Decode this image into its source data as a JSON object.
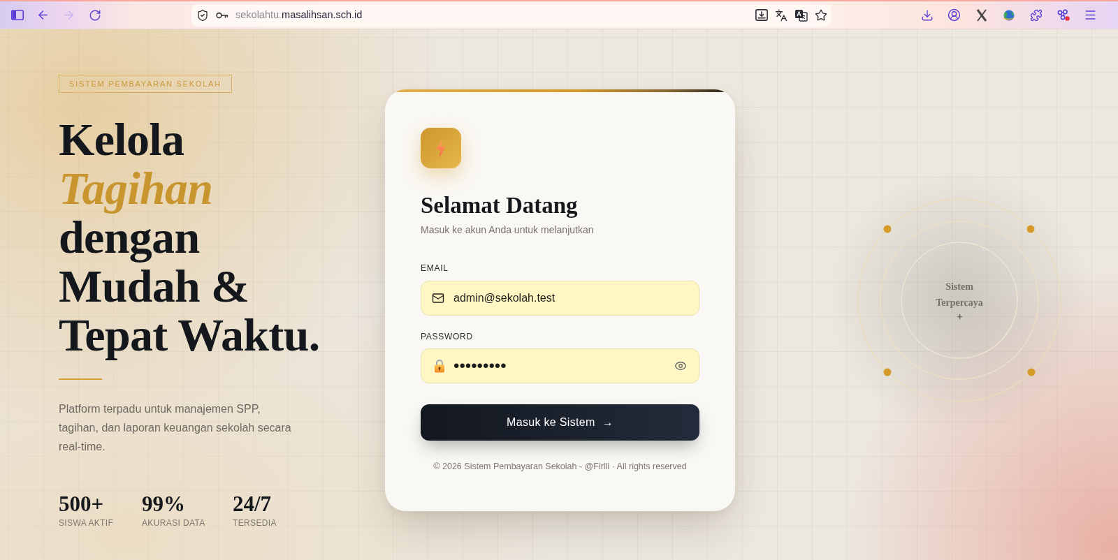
{
  "browser": {
    "forward_disabled": true,
    "url_prefix": "sekolahtu.",
    "url_host": "masalihsan.sch.id"
  },
  "hero": {
    "badge": "SISTEM PEMBAYARAN SEKOLAH",
    "headline": [
      {
        "text": "Kelola",
        "kind": "plain"
      },
      {
        "text": "Tagihan",
        "kind": "accent"
      },
      {
        "text": "dengan",
        "kind": "plain"
      },
      {
        "text": "Mudah &",
        "kind": "plain"
      },
      {
        "text": "Tepat Waktu.",
        "kind": "plain"
      }
    ],
    "description": "Platform terpadu untuk manajemen SPP, tagihan, dan laporan keuangan sekolah secara real-time.",
    "stats": [
      {
        "value": "500+",
        "label": "SISWA AKTIF"
      },
      {
        "value": "99%",
        "label": "AKURASI DATA"
      },
      {
        "value": "24/7",
        "label": "TERSEDIA"
      }
    ]
  },
  "login_card": {
    "title": "Selamat Datang",
    "subtitle": "Masuk ke akun Anda untuk melanjutkan",
    "fields": [
      {
        "kind": "email",
        "label": "EMAIL",
        "value": "admin@sekolah.test"
      },
      {
        "kind": "password",
        "label": "PASSWORD",
        "value": "•••••••••"
      }
    ],
    "submit": {
      "label": "Masuk ke Sistem",
      "arrow": "→"
    },
    "footer": "© 2026 Sistem Pembayaran Sekolah - @Firlli · All rights reserved"
  },
  "badge_ring": {
    "caption": "Sistem Terpercaya"
  }
}
